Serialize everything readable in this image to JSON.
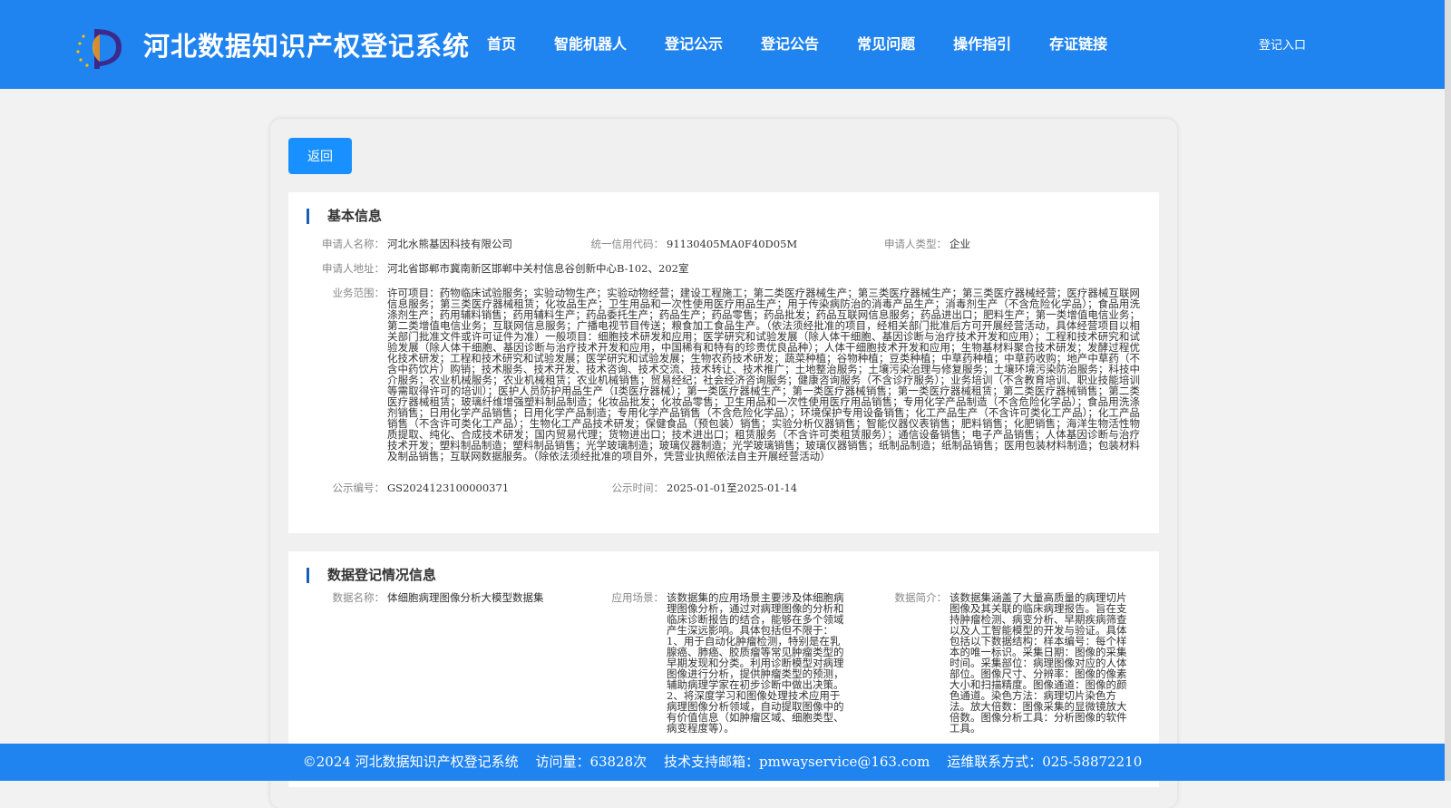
{
  "header": {
    "title": "河北数据知识产权登记系统",
    "nav": [
      "首页",
      "智能机器人",
      "登记公示",
      "登记公告",
      "常见问题",
      "操作指引",
      "存证链接"
    ],
    "login": "登记入口"
  },
  "back_label": "返回",
  "basic": {
    "title": "基本信息",
    "applicant_label": "申请人名称：",
    "applicant": "河北水熊基因科技有限公司",
    "credit_label": "统一信用代码：",
    "credit": "91130405MA0F40D05M",
    "type_label": "申请人类型：",
    "type": "企业",
    "address_label": "申请人地址：",
    "address": "河北省邯郸市冀南新区邯郸中关村信息谷创新中心B-102、202室",
    "scope_label": "业务范围：",
    "scope": "许可项目：药物临床试验服务；实验动物生产；实验动物经营；建设工程施工；第二类医疗器械生产；第三类医疗器械生产；第三类医疗器械经营；医疗器械互联网信息服务；第三类医疗器械租赁；化妆品生产；卫生用品和一次性使用医疗用品生产；用于传染病防治的消毒产品生产；消毒剂生产（不含危险化学品）；食品用洗涤剂生产；药用辅料销售；药用辅料生产；药品委托生产；药品生产；药品零售；药品批发；药品互联网信息服务；药品进出口；肥料生产；第一类增值电信业务；第二类增值电信业务；互联网信息服务；广播电视节目传送；粮食加工食品生产。（依法须经批准的项目，经相关部门批准后方可开展经营活动，具体经营项目以相关部门批准文件或许可证件为准）一般项目：细胞技术研发和应用；医学研究和试验发展（除人体干细胞、基因诊断与治疗技术开发和应用）；工程和技术研究和试验发展（除人体干细胞、基因诊断与治疗技术开发和应用，中国稀有和特有的珍贵优良品种）；人体干细胞技术开发和应用；生物基材料聚合技术研发；发酵过程优化技术研发；工程和技术研究和试验发展；医学研究和试验发展；生物农药技术研发；蔬菜种植；谷物种植；豆类种植；中草药种植；中草药收购；地产中草药（不含中药饮片）购销；技术服务、技术开发、技术咨询、技术交流、技术转让、技术推广；土地整治服务；土壤污染治理与修复服务；土壤环境污染防治服务；科技中介服务；农业机械服务；农业机械租赁；农业机械销售；贸易经纪；社会经济咨询服务；健康咨询服务（不含诊疗服务）；业务培训（不含教育培训、职业技能培训等需取得许可的培训）；医护人员防护用品生产（Ⅰ类医疗器械）；第一类医疗器械生产；第一类医疗器械销售；第一类医疗器械租赁；第二类医疗器械销售；第二类医疗器械租赁；玻璃纤维增强塑料制品制造；化妆品批发；化妆品零售；卫生用品和一次性使用医疗用品销售；专用化学产品制造（不含危险化学品）；食品用洗涤剂销售；日用化学产品销售；日用化学产品制造；专用化学产品销售（不含危险化学品）；环境保护专用设备销售；化工产品生产（不含许可类化工产品）；化工产品销售（不含许可类化工产品）；生物化工产品技术研发；保健食品（预包装）销售；实验分析仪器销售；智能仪器仪表销售；肥料销售；化肥销售；海洋生物活性物质提取、纯化、合成技术研发；国内贸易代理；货物进出口；技术进出口；租赁服务（不含许可类租赁服务）；通信设备销售；电子产品销售；人体基因诊断与治疗技术开发；塑料制品制造；塑料制品销售；光学玻璃制造；玻璃仪器制造；光学玻璃销售；玻璃仪器销售；纸制品制造；纸制品销售；医用包装材料制造；包装材料及制品销售；互联网数据服务。（除依法须经批准的项目外，凭营业执照依法自主开展经营活动）",
    "pub_no_label": "公示编号：",
    "pub_no": "GS2024123100000371",
    "pub_time_label": "公示时间：",
    "pub_time": "2025-01-01至2025-01-14"
  },
  "reg": {
    "title": "数据登记情况信息",
    "name_label": "数据名称：",
    "name": "体细胞病理图像分析大模型数据集",
    "scene_label": "应用场景：",
    "scene": "该数据集的应用场景主要涉及体细胞病理图像分析，通过对病理图像的分析和临床诊断报告的结合，能够在多个领域产生深远影响。具体包括但不限于：1、用于自动化肿瘤检测，特别是在乳腺癌、肺癌、胶质瘤等常见肿瘤类型的早期发现和分类。利用诊断模型对病理图像进行分析，提供肿瘤类型的预测，辅助病理学家在初步诊断中做出决策。2、将深度学习和图像处理技术应用于病理图像分析领域，自动提取图像中的有价值信息（如肿瘤区域、细胞类型、病变程度等）。",
    "intro_label": "数据简介：",
    "intro": "该数据集涵盖了大量高质量的病理切片图像及其关联的临床病理报告。旨在支持肿瘤检测、病变分析、早期疾病筛查以及人工智能模型的开发与验证。具体包括以下数据结构：样本编号：每个样本的唯一标识。采集日期：图像的采集时间。采集部位：病理图像对应的人体部位。图像尺寸、分辨率：图像的像素大小和扫描精度。图像通道：图像的颜色通道。染色方法：病理切片染色方法。放大倍数：图像采集的显微镜放大倍数。图像分析工具：分析图像的软件工具。"
  },
  "footer": {
    "copyright": "©2024 河北数据知识产权登记系统",
    "visits": "访问量：63828次",
    "email": "技术支持邮箱：pmwayservice@163.com",
    "phone": "运维联系方式：025-58872210"
  },
  "colors": {
    "primary": "#1f83f0",
    "button": "#1890ff",
    "section_bar": "#1a5fb4"
  }
}
